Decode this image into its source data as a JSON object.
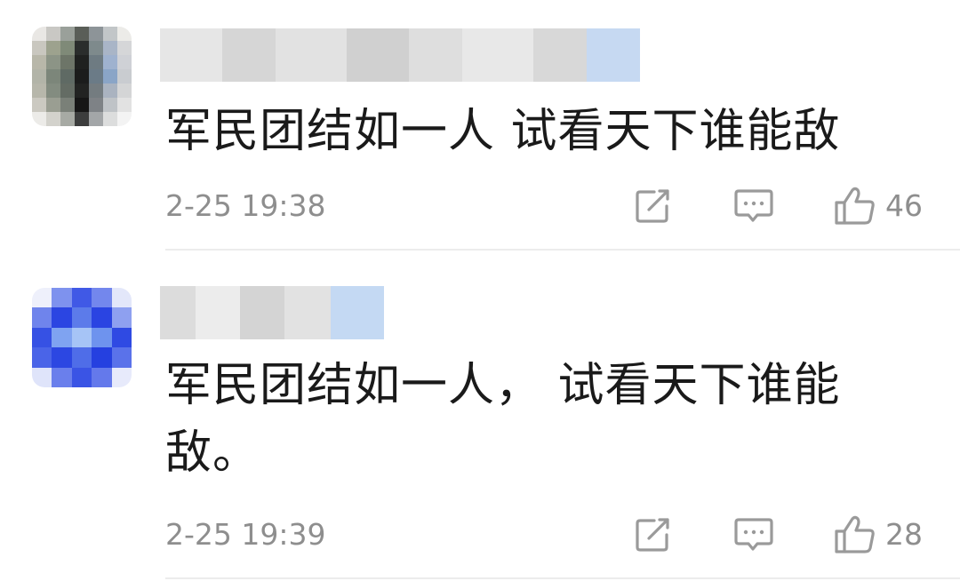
{
  "comments": [
    {
      "text": "军民团结如一人 试看天下谁能敌",
      "time": "2-25 19:38",
      "likes": "46",
      "share_icon": "share-icon",
      "reply_icon": "comment-icon",
      "like_icon": "thumbs-up-icon"
    },
    {
      "text": "军民团结如一人， 试看天下谁能敌。",
      "time": "2-25 19:39",
      "likes": "28",
      "share_icon": "share-icon",
      "reply_icon": "comment-icon",
      "like_icon": "thumbs-up-icon"
    }
  ],
  "colors": {
    "text": "#1a1a1a",
    "meta": "#8e8e8e",
    "icon": "#9a9a9a",
    "divider": "#ececec"
  }
}
